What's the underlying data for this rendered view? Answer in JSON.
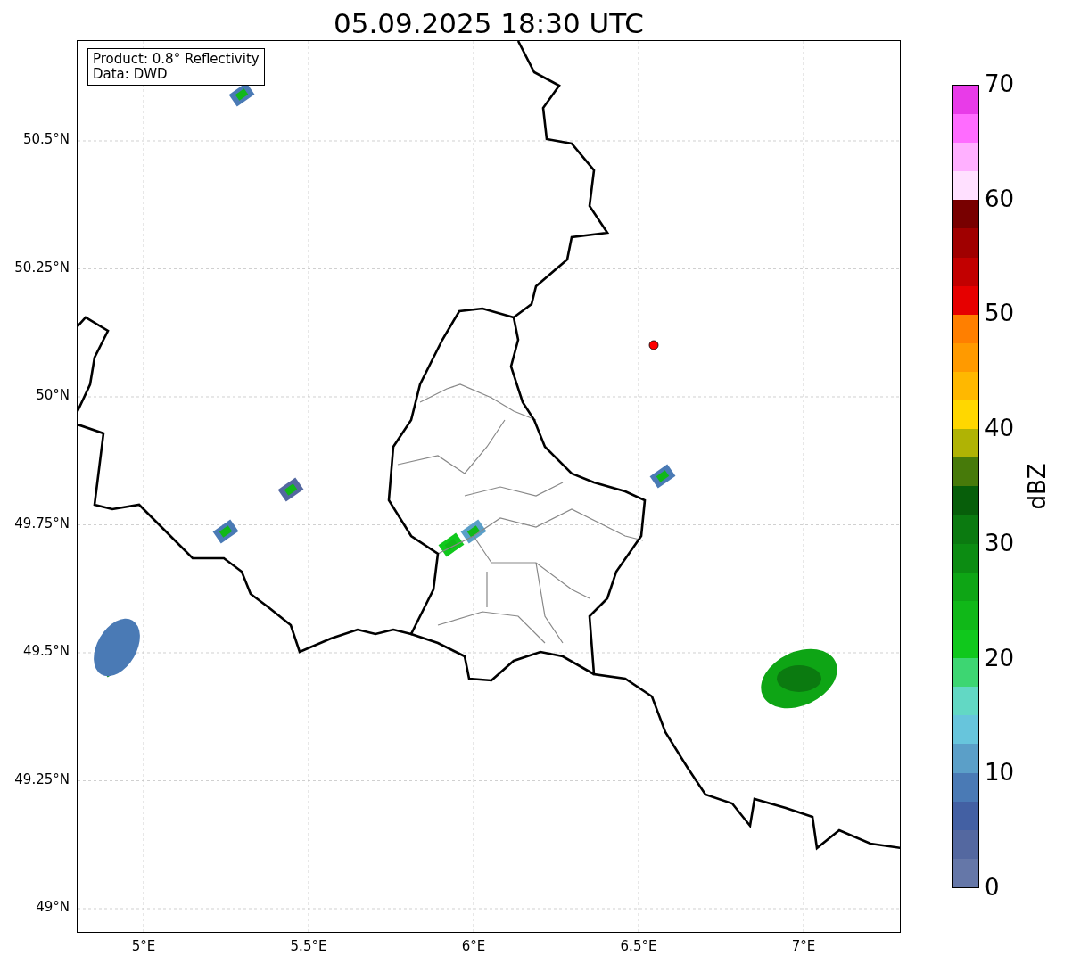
{
  "title": "05.09.2025 18:30 UTC",
  "info_box": [
    "Product: 0.8° Reflectivity",
    "Data: DWD"
  ],
  "y_ticks": [
    "50.5°N",
    "50.25°N",
    "50°N",
    "49.75°N",
    "49.5°N",
    "49.25°N",
    "49°N"
  ],
  "x_ticks": [
    "5°E",
    "5.5°E",
    "6°E",
    "6.5°E",
    "7°E"
  ],
  "colorbar": {
    "label": "dBZ",
    "ticks": [
      "70",
      "60",
      "50",
      "40",
      "30",
      "20",
      "10",
      "0"
    ],
    "bins": [
      {
        "color": "#6577a8"
      },
      {
        "color": "#5468a0"
      },
      {
        "color": "#4360a3"
      },
      {
        "color": "#4a7ab5"
      },
      {
        "color": "#5b9fc8"
      },
      {
        "color": "#67c5dc"
      },
      {
        "color": "#62d8c4"
      },
      {
        "color": "#3dd672"
      },
      {
        "color": "#10c81c"
      },
      {
        "color": "#10b818"
      },
      {
        "color": "#0ea515"
      },
      {
        "color": "#0c8c12"
      },
      {
        "color": "#0b7a10"
      },
      {
        "color": "#075e0a"
      },
      {
        "color": "#477a0a"
      },
      {
        "color": "#b0b304"
      },
      {
        "color": "#ffd700"
      },
      {
        "color": "#ffb800"
      },
      {
        "color": "#ff9a00"
      },
      {
        "color": "#ff7f00"
      },
      {
        "color": "#e60000"
      },
      {
        "color": "#c20000"
      },
      {
        "color": "#a00000"
      },
      {
        "color": "#780000"
      },
      {
        "color": "#ffe0ff"
      },
      {
        "color": "#ffb0ff"
      },
      {
        "color": "#ff6cff"
      },
      {
        "color": "#e83be8"
      }
    ]
  }
}
